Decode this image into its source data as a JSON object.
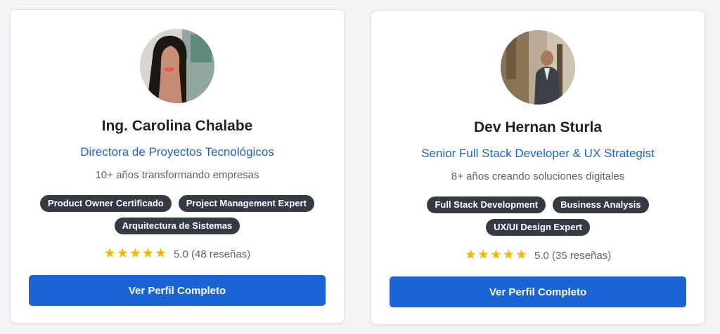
{
  "cards": [
    {
      "name": "Ing. Carolina Chalabe",
      "title": "Directora de Proyectos Tecnológicos",
      "subtitle": "10+ años transformando empresas",
      "badges": [
        "Product Owner Certificado",
        "Project Management Expert",
        "Arquitectura de Sistemas"
      ],
      "rating": {
        "stars": "★★★★★",
        "text": "5.0 (48 reseñas)"
      },
      "cta_label": "Ver Perfil Completo",
      "avatar_icon": "avatar-photo"
    },
    {
      "name": "Dev Hernan Sturla",
      "title": "Senior Full Stack Developer & UX Strategist",
      "subtitle": "8+ años creando soluciones digitales",
      "badges": [
        "Full Stack Development",
        "Business Analysis",
        "UX/UI Design Expert"
      ],
      "rating": {
        "stars": "★★★★★",
        "text": "5.0 (35 reseñas)"
      },
      "cta_label": "Ver Perfil Completo",
      "avatar_icon": "avatar-photo"
    }
  ],
  "colors": {
    "accent": "#1a64d6",
    "title_blue": "#1a64c8",
    "badge_bg": "#353b45",
    "star": "#f5b800"
  }
}
